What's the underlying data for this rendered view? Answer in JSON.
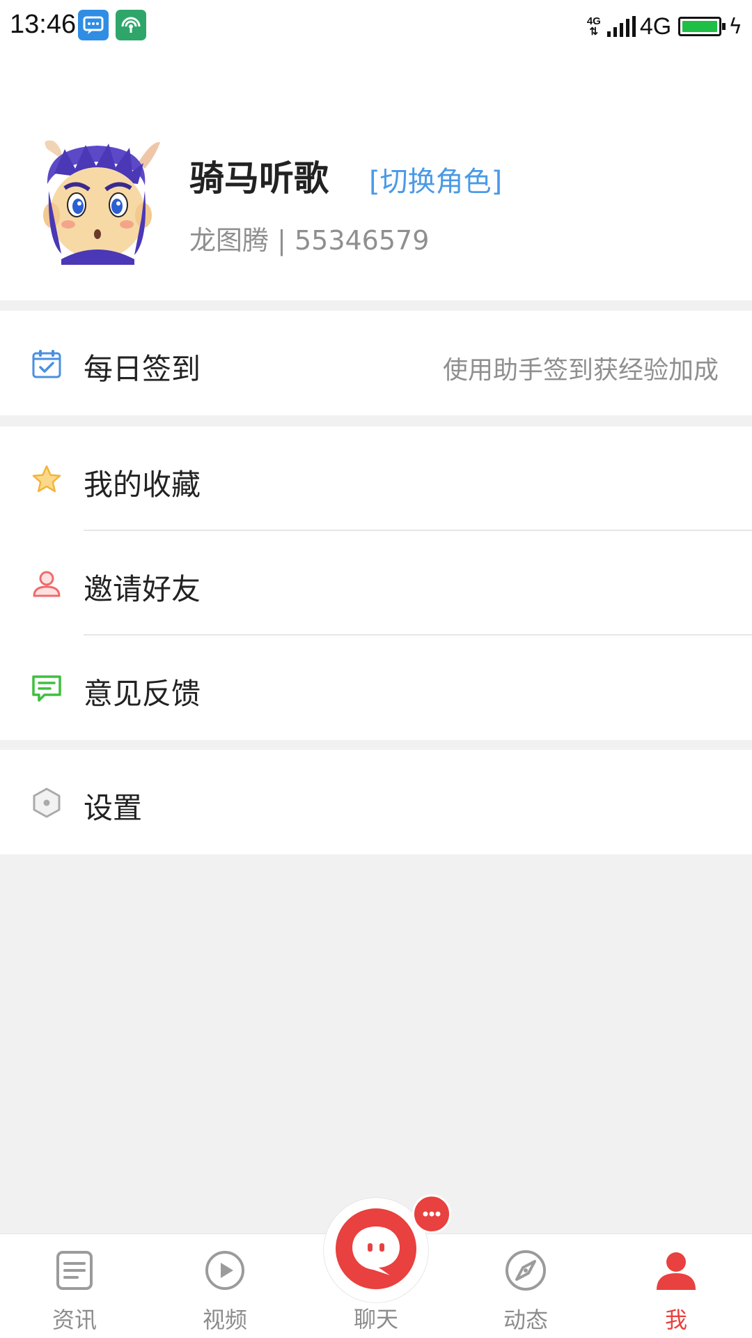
{
  "status_bar": {
    "time": "13:46",
    "network_small": "4G",
    "network_type": "4G",
    "battery_charging": true,
    "notification_icons": [
      "message-app-icon",
      "hotspot-app-icon"
    ]
  },
  "profile": {
    "username": "骑马听歌",
    "switch_role": "[切换角色]",
    "server_id": "龙图腾 | 55346579"
  },
  "menu": {
    "daily_checkin": {
      "label": "每日签到",
      "hint": "使用助手签到获经验加成",
      "icon": "calendar-check-icon"
    },
    "favorites": {
      "label": "我的收藏",
      "icon": "star-icon"
    },
    "invite_friends": {
      "label": "邀请好友",
      "icon": "user-icon"
    },
    "feedback": {
      "label": "意见反馈",
      "icon": "chat-bubble-icon"
    },
    "settings": {
      "label": "设置",
      "icon": "hexagon-settings-icon"
    }
  },
  "bottom_nav": {
    "news": "资讯",
    "video": "视频",
    "chat": "聊天",
    "moments": "动态",
    "me": "我",
    "active": "me"
  },
  "colors": {
    "accent_red": "#e8413f",
    "link_blue": "#4a9ae6",
    "background_gray": "#f1f1f1"
  }
}
